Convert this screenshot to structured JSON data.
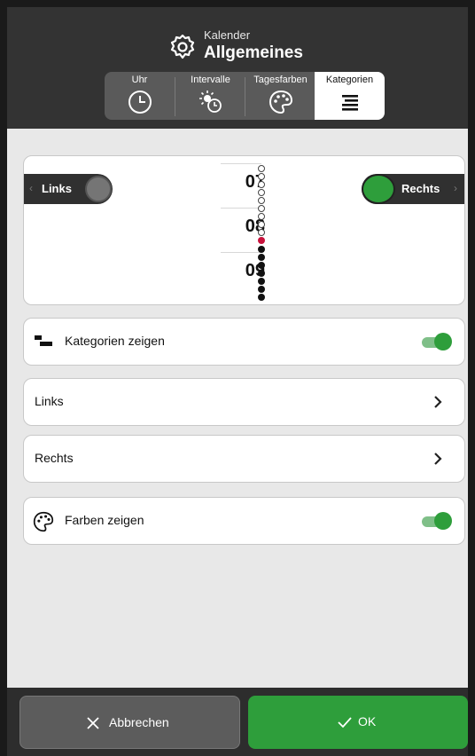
{
  "header": {
    "subtitle": "Kalender",
    "title": "Allgemeines",
    "title_icon": "gear-icon"
  },
  "tabs": [
    {
      "label": "Uhr",
      "icon": "clock-icon",
      "active": false
    },
    {
      "label": "Intervalle",
      "icon": "sun-clock-icon",
      "active": false
    },
    {
      "label": "Tagesfarben",
      "icon": "palette-icon",
      "active": false
    },
    {
      "label": "Kategorien",
      "icon": "align-lines-icon",
      "active": true
    }
  ],
  "preview": {
    "left_label": "Links",
    "right_label": "Rechts",
    "left_chevron": "‹",
    "right_chevron": "›",
    "hours": [
      "07",
      "08",
      "09"
    ]
  },
  "settings": {
    "show_categories": {
      "label": "Kategorien zeigen",
      "on": true
    },
    "left": {
      "label": "Links"
    },
    "right": {
      "label": "Rechts"
    },
    "show_colors": {
      "label": "Farben zeigen",
      "on": true
    }
  },
  "footer": {
    "cancel_label": "Abbrechen",
    "ok_label": "OK"
  },
  "colors": {
    "accent_green": "#2e9e3b",
    "header_bg": "#333333",
    "marker_red": "#c8123c"
  }
}
